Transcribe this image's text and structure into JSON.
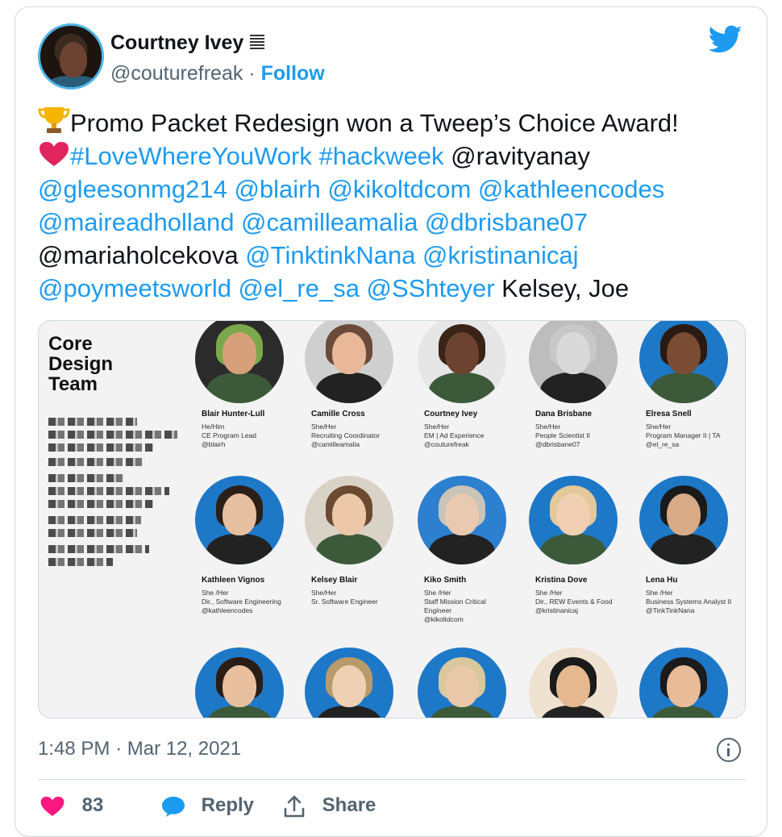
{
  "author": {
    "name": "Courtney Ivey",
    "handle": "@couturefreak",
    "separator": "·",
    "follow_label": "Follow"
  },
  "tweet": {
    "line1_text": "Promo Packet Redesign won a Tweep’s Choice Award!",
    "line2_links": "#LoveWhereYouWork #hackweek",
    "line2_mention": "@ravityanay",
    "line3": "@gleesonmg214 @blairh @kikoltdcom @kathleencodes",
    "line4": "@maireadholland @camilleamalia @dbrisbane07",
    "line5_plain": "@mariaholcekova",
    "line5_links": "@TinktinkNana @kristinanicaj",
    "line6_links": "@poymeetsworld @el_re_sa @SShteyer",
    "line6_plain": "Kelsey, Joe",
    "emoji": [
      "trophy-emoji",
      "red-heart-emoji"
    ]
  },
  "media": {
    "title_line1": "Core",
    "title_line2": "Design",
    "title_line3": "Team",
    "people": [
      {
        "name": "Blair Hunter-Lull",
        "pronouns": "He/Him",
        "role": "CE Program Lead",
        "handle": "@blairh"
      },
      {
        "name": "Camille Cross",
        "pronouns": "She/Her",
        "role": "Recruiting Coordinator",
        "handle": "@camilleamalia"
      },
      {
        "name": "Courtney Ivey",
        "pronouns": "She/Her",
        "role": "EM | Ad Experience",
        "handle": "@couturefreak"
      },
      {
        "name": "Dana Brisbane",
        "pronouns": "She/Her",
        "role": "People Scientist II",
        "handle": "@dbrisbane07"
      },
      {
        "name": "Elresa Snell",
        "pronouns": "She/Her",
        "role": "Program Manager II | TA",
        "handle": "@el_re_sa"
      },
      {
        "name": "Kathleen Vignos",
        "pronouns": "She /Her",
        "role": "Dir., Software Engineering",
        "handle": "@kathleencodes"
      },
      {
        "name": "Kelsey Blair",
        "pronouns": "She/Her",
        "role": "Sr. Software Engineer",
        "handle": ""
      },
      {
        "name": "Kiko Smith",
        "pronouns": "She /Her",
        "role": "Staff Mission Critical",
        "role2": "Engineer",
        "handle": "@kikoltdcom"
      },
      {
        "name": "Kristina Dove",
        "pronouns": "She /Her",
        "role": "Dir., REW Events & Food",
        "handle": "@kristinanicaj"
      },
      {
        "name": "Lena Hu",
        "pronouns": "She /Her",
        "role": "Business Systems Analyst II",
        "handle": "@TinkTinkNana"
      }
    ]
  },
  "meta": {
    "time": "1:48 PM",
    "separator": "·",
    "date": "Mar 12, 2021"
  },
  "actions": {
    "like_count": "83",
    "reply_label": "Reply",
    "share_label": "Share"
  },
  "colors": {
    "link": "#1d9bf0",
    "like": "#f91880",
    "secondary_text": "#536471"
  }
}
